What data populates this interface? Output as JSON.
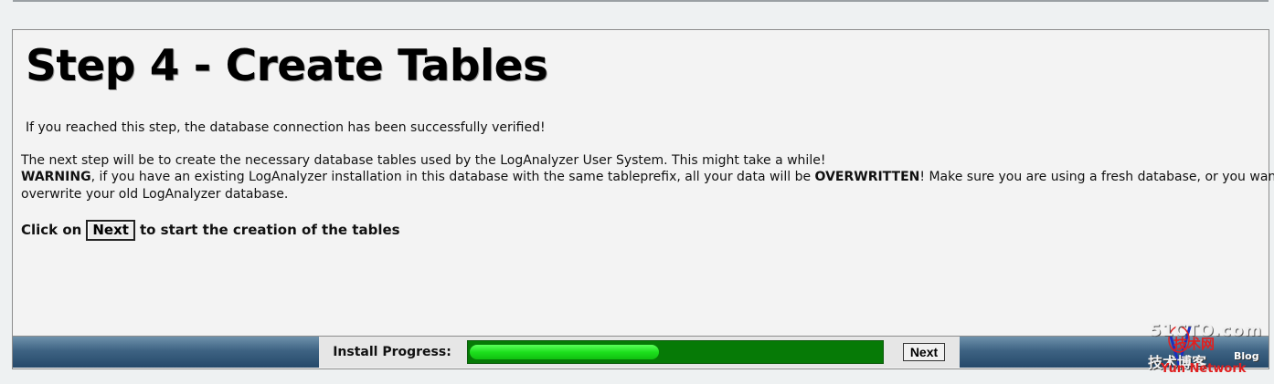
{
  "page": {
    "title": "Step 4 - Create Tables",
    "line_verified": "If you reached this step, the database connection has been successfully verified!",
    "line_next_step": "The next step will be to create the necessary database tables used by the LogAnalyzer User System. This might take a while!",
    "warning_label": "WARNING",
    "warning_text_1": ", if you have an existing LogAnalyzer installation in this database with the same tableprefix, all your data will be ",
    "overwritten_label": "OVERWRITTEN",
    "warning_text_2": "! Make sure you are using a fresh database, or you want to",
    "line_overwrite": "overwrite your old LogAnalyzer database.",
    "click_prefix": "Click on",
    "click_button": "Next",
    "click_suffix": "to start the creation of the tables"
  },
  "progress_bar": {
    "label": "Install Progress:",
    "progress_fraction": 0.46,
    "next_button": "Next"
  },
  "watermark": {
    "domain": "51CTO.com",
    "cn_top": "技术网",
    "cn_bottom": "技术博客",
    "blog": "Blog",
    "network": "Yun Network"
  },
  "colors": {
    "background": "#eef1f2",
    "panel": "#f3f3f3",
    "progress_track": "#067a06",
    "progress_fill": "#1de01d",
    "bar_blue": "#3e6383"
  }
}
